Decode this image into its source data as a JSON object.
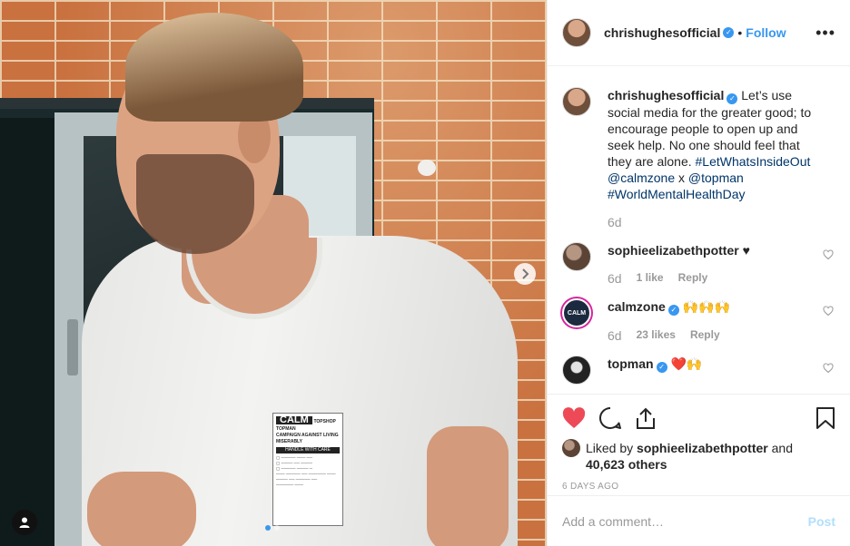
{
  "post_header": {
    "username": "chrishughesofficial",
    "separator": "•",
    "follow_label": "Follow",
    "more_label": "•••"
  },
  "comments": [
    {
      "username": "chrishughesofficial",
      "verified": true,
      "text_parts": [
        {
          "t": "Let’s use social media for the greater good; to encourage people to open up and seek help. No one should feel that they are alone. "
        },
        {
          "t": "#LetWhatsInsideOut",
          "link": true
        },
        {
          "t": " "
        },
        {
          "t": "@calmzone",
          "link": true
        },
        {
          "t": " x "
        },
        {
          "t": "@topman",
          "link": true
        },
        {
          "t": " "
        },
        {
          "t": "#WorldMentalHealthDay",
          "link": true
        }
      ],
      "time": "6d"
    },
    {
      "username": "sophieelizabethpotter",
      "verified": false,
      "text": "♥",
      "time": "6d",
      "likes": "1 like",
      "reply": "Reply"
    },
    {
      "username": "calmzone",
      "verified": true,
      "text": "🙌🙌🙌",
      "time": "6d",
      "likes": "23 likes",
      "reply": "Reply",
      "avatar_text": "CALM"
    },
    {
      "username": "topman",
      "verified": true,
      "text": "❤️🙌"
    }
  ],
  "likes": {
    "prefix": "Liked by",
    "user": "sophieelizabethpotter",
    "and": "and",
    "count": "40,623 others"
  },
  "date": "6 DAYS AGO",
  "add_comment": {
    "placeholder": "Add a comment…",
    "post_label": "Post"
  },
  "photo": {
    "label_title": "CALM",
    "label_brand": "TOPSHOP TOPMAN",
    "label_sub": "CAMPAIGN AGAINST LIVING MISERABLY",
    "label_care": "HANDLE WITH CARE",
    "carousel_index": 1,
    "carousel_count": 2
  },
  "colors": {
    "accent": "#3897f0",
    "like_red": "#ed4956",
    "link": "#003569",
    "muted": "#999999"
  }
}
